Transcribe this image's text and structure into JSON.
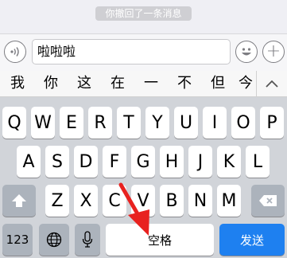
{
  "chat": {
    "recall_notice": "你撤回了一条消息"
  },
  "input_bar": {
    "text_value": "啦啦啦"
  },
  "candidates": [
    "我",
    "你",
    "这",
    "在",
    "一",
    "不",
    "但",
    "今"
  ],
  "keyboard": {
    "row1": [
      "Q",
      "W",
      "E",
      "R",
      "T",
      "Y",
      "U",
      "I",
      "O",
      "P"
    ],
    "row2": [
      "A",
      "S",
      "D",
      "F",
      "G",
      "H",
      "J",
      "K",
      "L"
    ],
    "row3": [
      "Z",
      "X",
      "C",
      "V",
      "B",
      "N",
      "M"
    ],
    "numbers_label": "123",
    "space_label": "空格",
    "send_label": "发送"
  },
  "colors": {
    "send_key": "#1e80f0",
    "annotation_arrow": "#e8211f"
  }
}
